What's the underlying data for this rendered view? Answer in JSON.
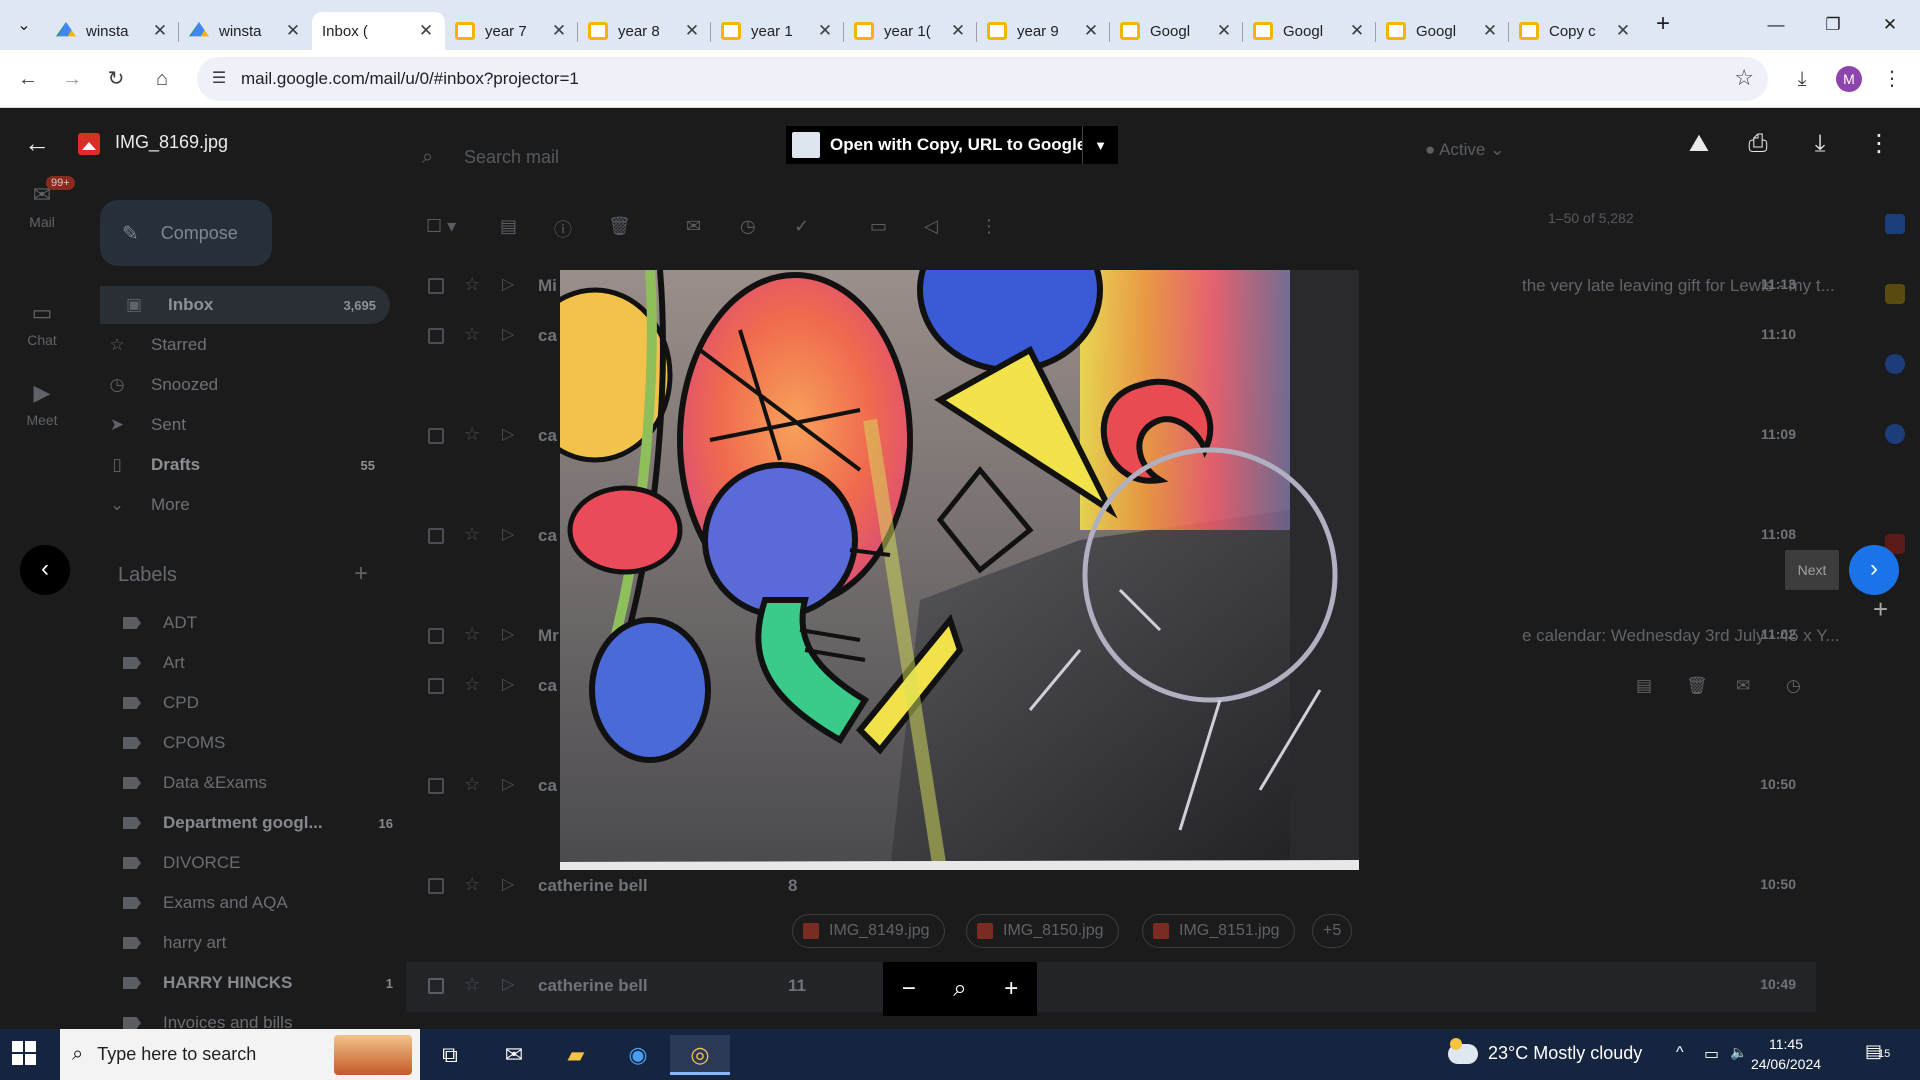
{
  "browser": {
    "tabs": [
      {
        "label": "winsta",
        "icon": "drive-icon",
        "active": false
      },
      {
        "label": "winsta",
        "icon": "drive-icon",
        "active": false
      },
      {
        "label": "Inbox (",
        "icon": "gmail-icon",
        "active": true
      },
      {
        "label": "year 7",
        "icon": "slides-icon",
        "active": false
      },
      {
        "label": "year 8",
        "icon": "slides-icon",
        "active": false
      },
      {
        "label": "year 1",
        "icon": "slides-icon",
        "active": false
      },
      {
        "label": "year 1(",
        "icon": "slides-icon",
        "active": false
      },
      {
        "label": "year 9",
        "icon": "slides-icon",
        "active": false
      },
      {
        "label": "Googl",
        "icon": "slides-icon",
        "active": false
      },
      {
        "label": "Googl",
        "icon": "slides-icon",
        "active": false
      },
      {
        "label": "Googl",
        "icon": "slides-icon",
        "active": false
      },
      {
        "label": "Copy c",
        "icon": "slides-icon",
        "active": false
      }
    ],
    "url": "mail.google.com/mail/u/0/#inbox?projector=1",
    "profile_initial": "M"
  },
  "gmail": {
    "rail": {
      "mail_label": "Mail",
      "mail_badge": "99+",
      "chat_label": "Chat",
      "meet_label": "Meet"
    },
    "compose_label": "Compose",
    "search_placeholder": "Search mail",
    "status": "Active",
    "nav": [
      {
        "label": "Inbox",
        "count": "3,695"
      },
      {
        "label": "Starred",
        "count": ""
      },
      {
        "label": "Snoozed",
        "count": ""
      },
      {
        "label": "Sent",
        "count": ""
      },
      {
        "label": "Drafts",
        "count": "55"
      },
      {
        "label": "More",
        "count": ""
      }
    ],
    "labels_heading": "Labels",
    "labels": [
      {
        "label": "ADT",
        "count": ""
      },
      {
        "label": "Art",
        "count": ""
      },
      {
        "label": "CPD",
        "count": ""
      },
      {
        "label": "CPOMS",
        "count": ""
      },
      {
        "label": "Data &Exams",
        "count": ""
      },
      {
        "label": "Department googl...",
        "count": "16"
      },
      {
        "label": "DIVORCE",
        "count": ""
      },
      {
        "label": "Exams and AQA",
        "count": ""
      },
      {
        "label": "harry art",
        "count": ""
      },
      {
        "label": "HARRY HINCKS",
        "count": "1"
      },
      {
        "label": "Invoices and bills",
        "count": ""
      }
    ],
    "pager": "1–50 of 5,282",
    "rows": [
      {
        "sender": "Mi",
        "count": "",
        "snippet": "the very late leaving gift for Lewis - my t...",
        "time": "11:13"
      },
      {
        "sender": "ca",
        "count": "",
        "snippet": "",
        "time": "11:10"
      },
      {
        "sender": "ca",
        "count": "",
        "snippet": "",
        "time": "11:09"
      },
      {
        "sender": "ca",
        "count": "",
        "snippet": "",
        "time": "11:08"
      },
      {
        "sender": "Mr",
        "count": "",
        "snippet": "e calendar: Wednesday 3rd July - 45 x Y...",
        "time": "11:02"
      },
      {
        "sender": "ca",
        "count": "",
        "snippet": "",
        "time": ""
      },
      {
        "sender": "ca",
        "count": "",
        "snippet": "",
        "time": "10:50"
      },
      {
        "sender": "catherine bell",
        "count": "8",
        "snippet": "",
        "time": "10:50"
      },
      {
        "sender": "catherine bell",
        "count": "11",
        "snippet": "",
        "time": "10:49"
      }
    ],
    "attachments": [
      "IMG_8149.jpg",
      "IMG_8150.jpg",
      "IMG_8151.jpg",
      "+5"
    ]
  },
  "viewer": {
    "filename": "IMG_8169.jpg",
    "open_with_label": "Open with Copy, URL to Google ...",
    "next_tooltip": "Next"
  },
  "taskbar": {
    "search_placeholder": "Type here to search",
    "weather": "23°C  Mostly cloudy",
    "time": "11:45",
    "date": "24/06/2024",
    "notifications": "15"
  }
}
